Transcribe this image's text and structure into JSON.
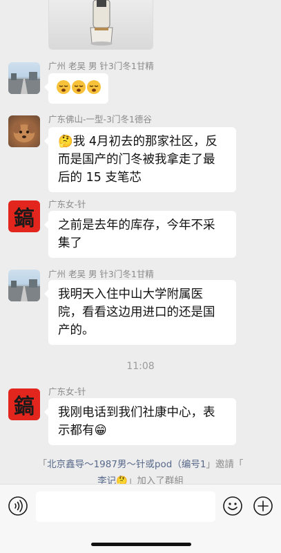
{
  "messages": [
    {
      "sender": "广州 老吴 男 针3门冬1甘精",
      "emojis": [
        "sleepy-face",
        "sleepy-face",
        "sleepy-face"
      ]
    },
    {
      "sender": "广东佛山-一型-3门冬1德谷",
      "text_line1": "🤔我 4月初去的那家社区，反",
      "text_line2": "而是国产的门冬被我拿走了最",
      "text_line3": "后的 15 支笔芯"
    },
    {
      "sender": "广东女-针",
      "text_line1": "之前是去年的库存，今年不采",
      "text_line2": "集了"
    },
    {
      "sender": "广州 老吴 男 针3门冬1甘精",
      "text_line1": "我明天入住中山大学附属医",
      "text_line2": "院，看看这边用进口的还是国",
      "text_line3": "产的。"
    },
    {
      "sender": "广东女-针",
      "text_line1": "我刚电话到我们社康中心，表",
      "text_line2": "示都有😁"
    }
  ],
  "timestamp": "11:08",
  "system_notice": {
    "open_quote": "「",
    "inviter": "北京鑫导～1987男～针或pod（编号1",
    "close_quote": "」",
    "verb": "邀請「",
    "invitee": "李记🤔",
    "tail": "」加入了群組"
  },
  "avatar_char": "鎬",
  "input": {
    "value": "",
    "placeholder": ""
  },
  "icons": {
    "voice": "voice-icon",
    "emoji": "emoji-icon",
    "plus": "plus-icon"
  }
}
